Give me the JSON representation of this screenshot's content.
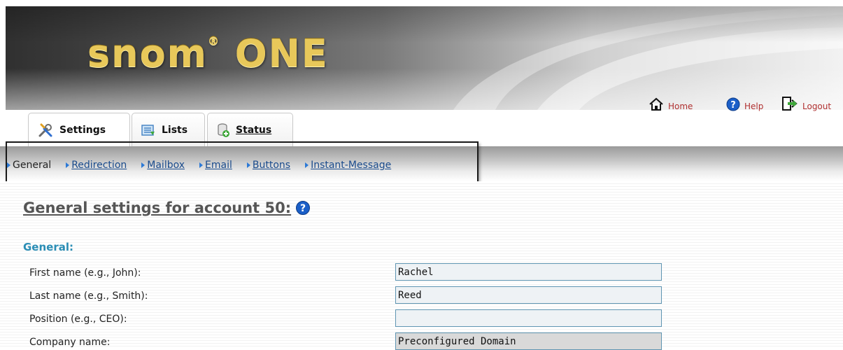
{
  "header": {
    "logo_text": "snom",
    "logo_sup": "®",
    "logo_product": "ONE",
    "links": [
      {
        "label": "Home",
        "icon": "home-icon"
      },
      {
        "label": "Help",
        "icon": "help-icon"
      },
      {
        "label": "Logout",
        "icon": "logout-icon"
      }
    ]
  },
  "tabs": [
    {
      "label": "Settings",
      "icon": "wrench-screwdriver-icon"
    },
    {
      "label": "Lists",
      "icon": "list-icon"
    },
    {
      "label": "Status",
      "icon": "status-icon"
    }
  ],
  "subnav": {
    "items": [
      {
        "label": "General",
        "active": true
      },
      {
        "label": "Redirection",
        "active": false
      },
      {
        "label": "Mailbox",
        "active": false
      },
      {
        "label": "Email",
        "active": false
      },
      {
        "label": "Buttons",
        "active": false
      },
      {
        "label": "Instant-Message",
        "active": false
      }
    ]
  },
  "main": {
    "title": "General settings for account 50:",
    "section": "General:",
    "fields": [
      {
        "label": "First name (e.g., John):",
        "value": "Rachel"
      },
      {
        "label": "Last name (e.g., Smith):",
        "value": "Reed"
      },
      {
        "label": "Position (e.g., CEO):",
        "value": ""
      },
      {
        "label": "Company name:",
        "value": "Preconfigured Domain"
      }
    ]
  },
  "colors": {
    "accent_blue": "#2a8db5",
    "link_red": "#b03030",
    "field_border": "#5f95b2",
    "logo_gold": "#e8c85a"
  }
}
